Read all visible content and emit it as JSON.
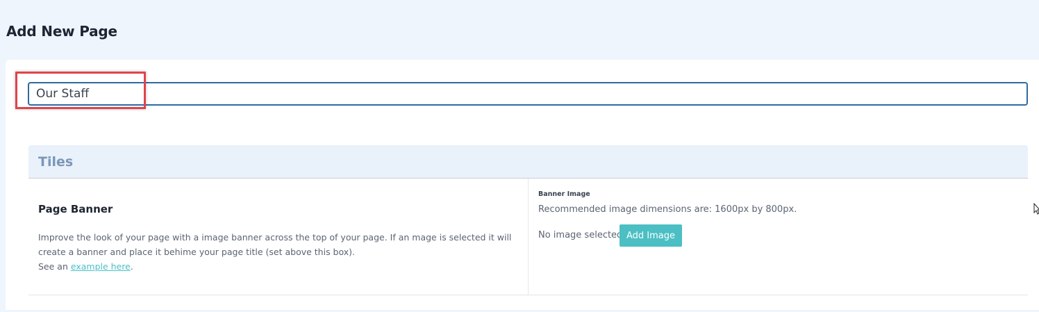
{
  "header": {
    "title": "Add New Page"
  },
  "page_title_input": {
    "value": "Our Staff"
  },
  "tiles": {
    "title": "Tiles",
    "page_banner": {
      "heading": "Page Banner",
      "description_line1": "Improve the look of your page with a image banner across the top of your page. If an mage is selected it will",
      "description_line2": "create a banner and place it behime your page title (set above this box).",
      "see_prefix": "See an ",
      "example_link": "example here",
      "see_suffix": ".",
      "banner_label": "Banner Image",
      "banner_hint": "Recommended image dimensions are: 1600px by 800px.",
      "no_image_text": "No image selected",
      "add_image_label": "Add Image"
    }
  },
  "colors": {
    "accent": "#4bbfc4",
    "input_border": "#2d6aa3",
    "highlight": "#e0434b",
    "page_bg": "#eef5fc"
  },
  "icons": {
    "cursor": "mouse-pointer-icon"
  }
}
